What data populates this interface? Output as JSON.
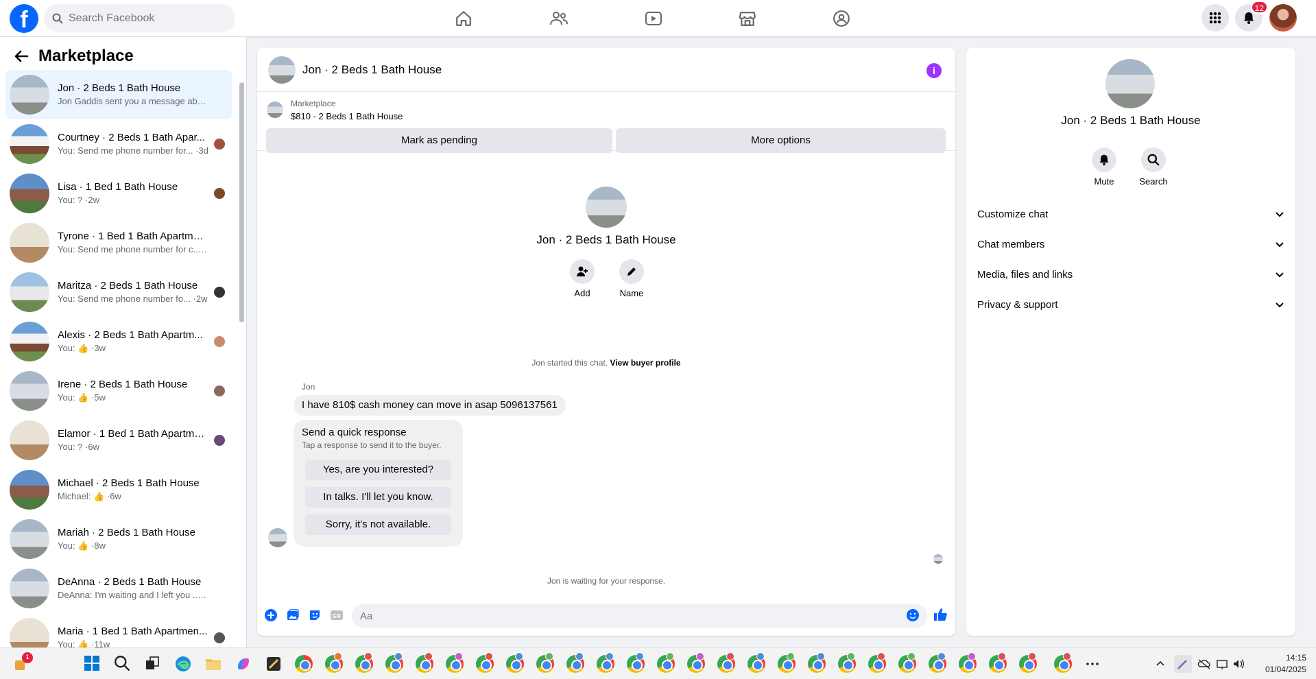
{
  "header": {
    "search_placeholder": "Search Facebook",
    "notification_count": "12"
  },
  "sidebar": {
    "title": "Marketplace",
    "conversations": [
      {
        "title": "Jon · 2 Beds 1 Bath House",
        "snippet": "Jon Gaddis sent you a message ab... ·8m"
      },
      {
        "title": "Courtney · 2 Beds 1 Bath Apar...",
        "snippet": "You: Send me phone number for... ·3d"
      },
      {
        "title": "Lisa · 1 Bed 1 Bath House",
        "snippet": "You: ? ·2w"
      },
      {
        "title": "Tyrone · 1 Bed 1 Bath Apartment...",
        "snippet": "You: Send me phone number for c... ·2w"
      },
      {
        "title": "Maritza · 2 Beds 1 Bath House",
        "snippet": "You: Send me phone number fo... ·2w"
      },
      {
        "title": "Alexis · 2 Beds 1 Bath Apartm...",
        "snippet": "You: 👍 ·3w"
      },
      {
        "title": "Irene · 2 Beds 1 Bath House",
        "snippet": "You: 👍 ·5w"
      },
      {
        "title": "Elamor · 1 Bed 1 Bath Apartme...",
        "snippet": "You: ? ·6w"
      },
      {
        "title": "Michael · 2 Beds 1 Bath House",
        "snippet": "Michael: 👍 ·6w"
      },
      {
        "title": "Mariah · 2 Beds 1 Bath House",
        "snippet": "You: 👍 ·8w"
      },
      {
        "title": "DeAnna · 2 Beds 1 Bath House",
        "snippet": "DeAnna: I'm waiting and I left you ... ·9w"
      },
      {
        "title": "Maria · 1 Bed 1 Bath Apartmen...",
        "snippet": "You: 👍 ·11w"
      }
    ]
  },
  "chat": {
    "title": "Jon · 2 Beds 1 Bath House",
    "listing_source": "Marketplace",
    "listing_price": "$810 - 2 Beds 1 Bath House",
    "mark_pending": "Mark as pending",
    "more_options": "More options",
    "center_name": "Jon · 2 Beds 1 Bath House",
    "add_label": "Add",
    "name_label": "Name",
    "started_text": "Jon started this chat.",
    "buyer_profile_link": "View buyer profile",
    "sender": "Jon",
    "message": "I have 810$ cash money can move in asap 5096137561",
    "quick_title": "Send a quick response",
    "quick_sub": "Tap a response to send it to the buyer.",
    "quick_responses": [
      "Yes, are you interested?",
      "In talks. I'll let you know.",
      "Sorry, it's not available."
    ],
    "waiting_text": "Jon is waiting for your response.",
    "input_placeholder": "Aa"
  },
  "info_panel": {
    "name": "Jon · 2 Beds 1 Bath House",
    "mute_label": "Mute",
    "search_label": "Search",
    "sections": [
      "Customize chat",
      "Chat members",
      "Media, files and links",
      "Privacy & support"
    ]
  },
  "taskbar": {
    "widget_badge": "1",
    "time": "14:15",
    "date": "01/04/2025"
  },
  "colors": {
    "accent": "#0866ff",
    "info": "#a033ff",
    "badge": "#e41e3f"
  }
}
